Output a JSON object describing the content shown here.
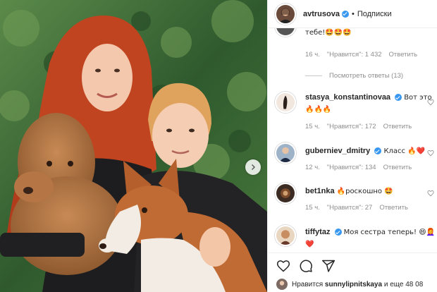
{
  "post": {
    "author": "avtrusova",
    "follow_label": "Подписки",
    "separator": "•"
  },
  "comments": [
    {
      "user": "",
      "text": "тебе!🤩🤩🤩",
      "time": "16 ч.",
      "likes": "\"Нравится\": 1 432",
      "reply": "Ответить",
      "view_replies": "Посмотреть ответы (13)"
    },
    {
      "user": "stasya_konstantinovaa",
      "text": "Вот это 🔥🔥🔥",
      "time": "15 ч.",
      "likes": "\"Нравится\": 172",
      "reply": "Ответить"
    },
    {
      "user": "guberniev_dmitry",
      "text": "Класс 🔥❤️",
      "time": "12 ч.",
      "likes": "\"Нравится\": 134",
      "reply": "Ответить"
    },
    {
      "user": "bet1nka",
      "text": "🔥роскошно 🤩",
      "time": "15 ч.",
      "likes": "\"Нравится\": 27",
      "reply": "Ответить"
    },
    {
      "user": "tiffytaz",
      "text": "Моя сестра теперь! 😄👩‍🦰❤️"
    }
  ],
  "likes_bar": {
    "prefix": "Нравится",
    "user": "sunnylipnitskaya",
    "suffix": "и еще 48 08"
  },
  "colors": {
    "verified": "#3897f0",
    "meta_text": "#8e8e8e",
    "border": "#efefef"
  },
  "icons": [
    "heart-icon",
    "comment-icon",
    "share-icon",
    "chevron-right-icon",
    "verified-icon"
  ]
}
